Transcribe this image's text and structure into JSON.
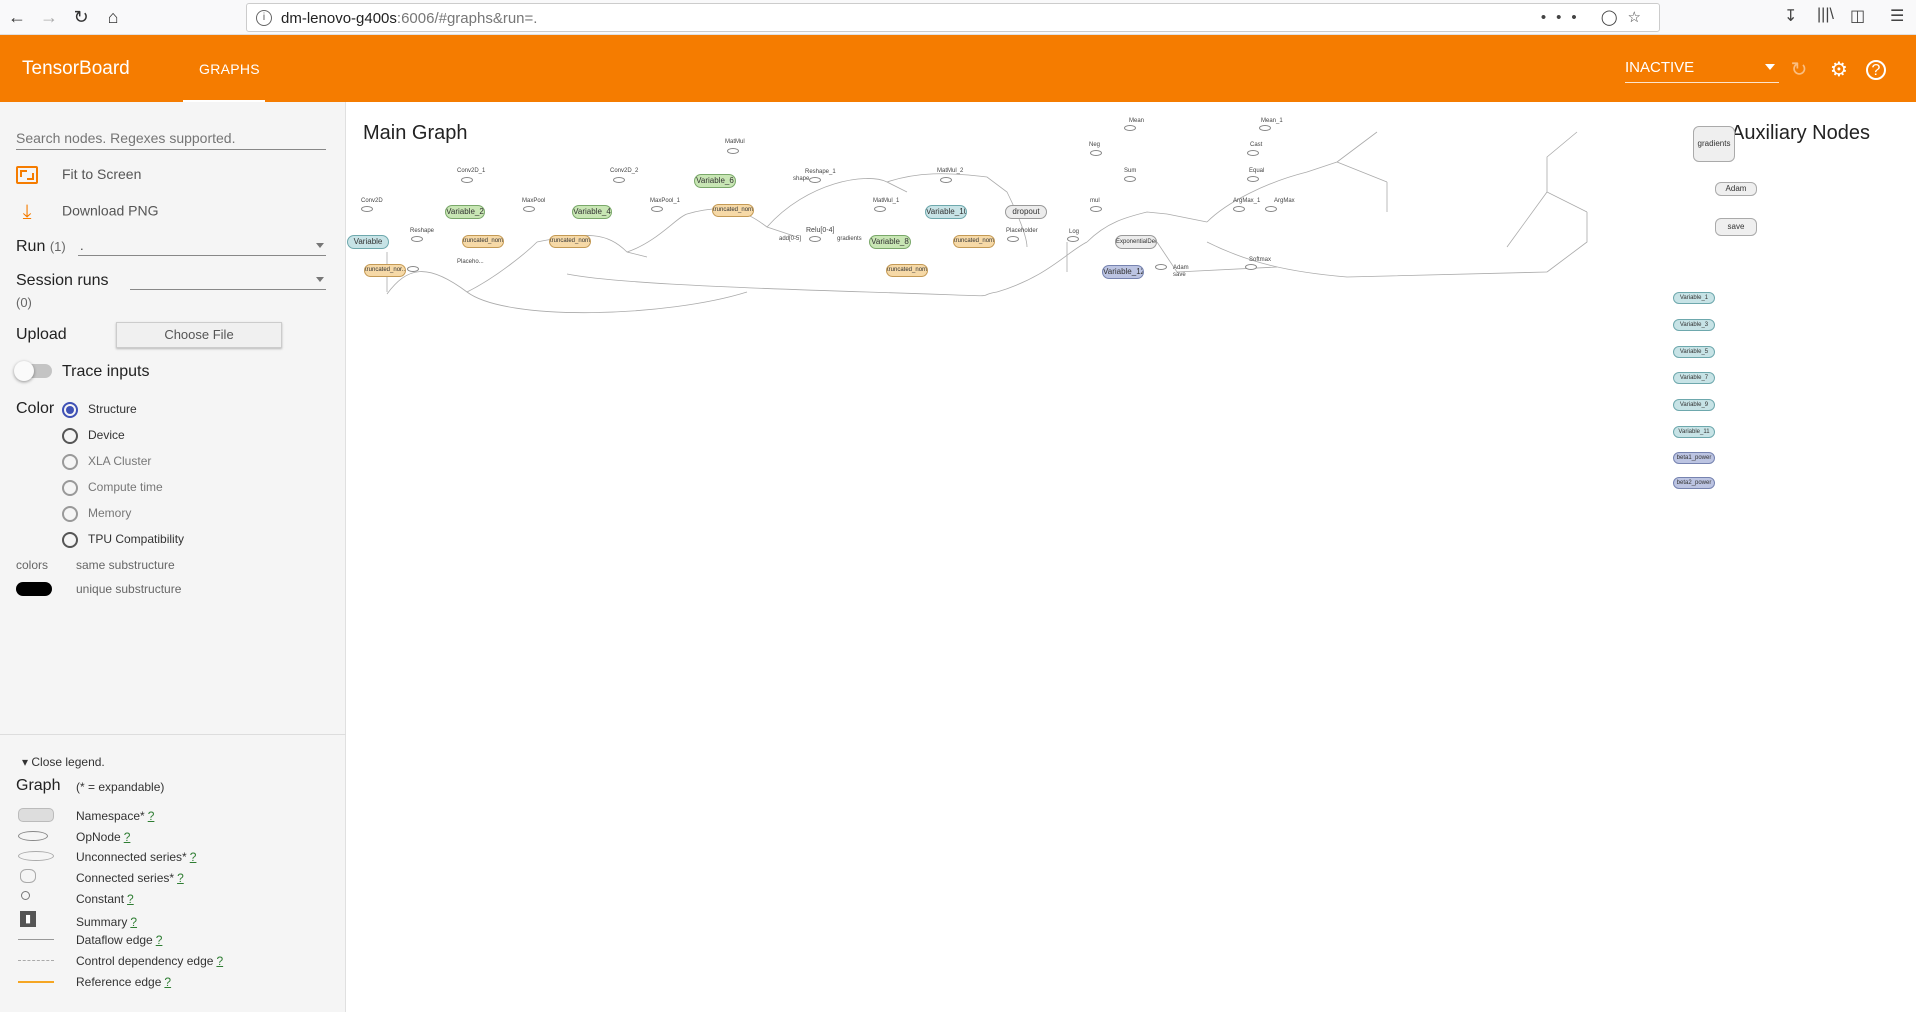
{
  "browser": {
    "url_host": "dm-lenovo-g400s",
    "url_rest": ":6006/#graphs&run=.",
    "more_label": "•••"
  },
  "header": {
    "title": "TensorBoard",
    "tab": "GRAPHS",
    "run_status": "INACTIVE",
    "accent_color": "#f57c00"
  },
  "sidebar": {
    "search_placeholder": "Search nodes. Regexes supported.",
    "fit_label": "Fit to Screen",
    "download_label": "Download PNG",
    "run_label": "Run",
    "run_count": "(1)",
    "run_value": ".",
    "session_label": "Session runs",
    "session_count": "(0)",
    "upload_label": "Upload",
    "choose_file": "Choose File",
    "trace_label": "Trace inputs",
    "color_label": "Color",
    "color_options": [
      "Structure",
      "Device",
      "XLA Cluster",
      "Compute time",
      "Memory",
      "TPU Compatibility"
    ],
    "colors_label": "colors",
    "same_sub": "same substructure",
    "unique_sub": "unique substructure"
  },
  "legend": {
    "close_label": "Close legend.",
    "graph_label": "Graph",
    "expandable_note": "(* = expandable)",
    "items": [
      "Namespace*",
      "OpNode",
      "Unconnected series*",
      "Connected series*",
      "Constant",
      "Summary",
      "Dataflow edge",
      "Control dependency edge",
      "Reference edge"
    ],
    "q": "?"
  },
  "graph": {
    "main_title": "Main Graph",
    "aux_title": "Auxiliary Nodes",
    "variable_nodes": [
      "Variable",
      "Variable_2",
      "Variable_4",
      "Variable_6",
      "Variable_8",
      "Variable_10",
      "Variable_12"
    ],
    "trunc_label_short": "truncated_nor...",
    "trunc_label": "truncated_normal...",
    "dropout": "dropout",
    "exp_decay": "ExponentialDec...",
    "relu": "Relu[0-4]",
    "aux_big": [
      "gradients",
      "Adam",
      "save"
    ],
    "aux_vars": [
      "Variable_1",
      "Variable_3",
      "Variable_5",
      "Variable_7",
      "Variable_9",
      "Variable_11",
      "beta1_power",
      "beta2_power"
    ],
    "op_labels": [
      "Conv2D",
      "Conv2D_1",
      "Conv2D_2",
      "MatMul",
      "Reshape_1",
      "MaxPool",
      "MaxPool_1",
      "MatMul_1",
      "MatMul_2",
      "Reshape",
      "Mean",
      "Neg",
      "Sum",
      "mul",
      "Log",
      "Mean_1",
      "Cast",
      "Equal",
      "ArgMax_1",
      "ArgMax",
      "Placeholder",
      "Placeho...",
      "Softmax",
      "add[0-5]",
      "gradients",
      "Adam",
      "save",
      "shape"
    ]
  }
}
